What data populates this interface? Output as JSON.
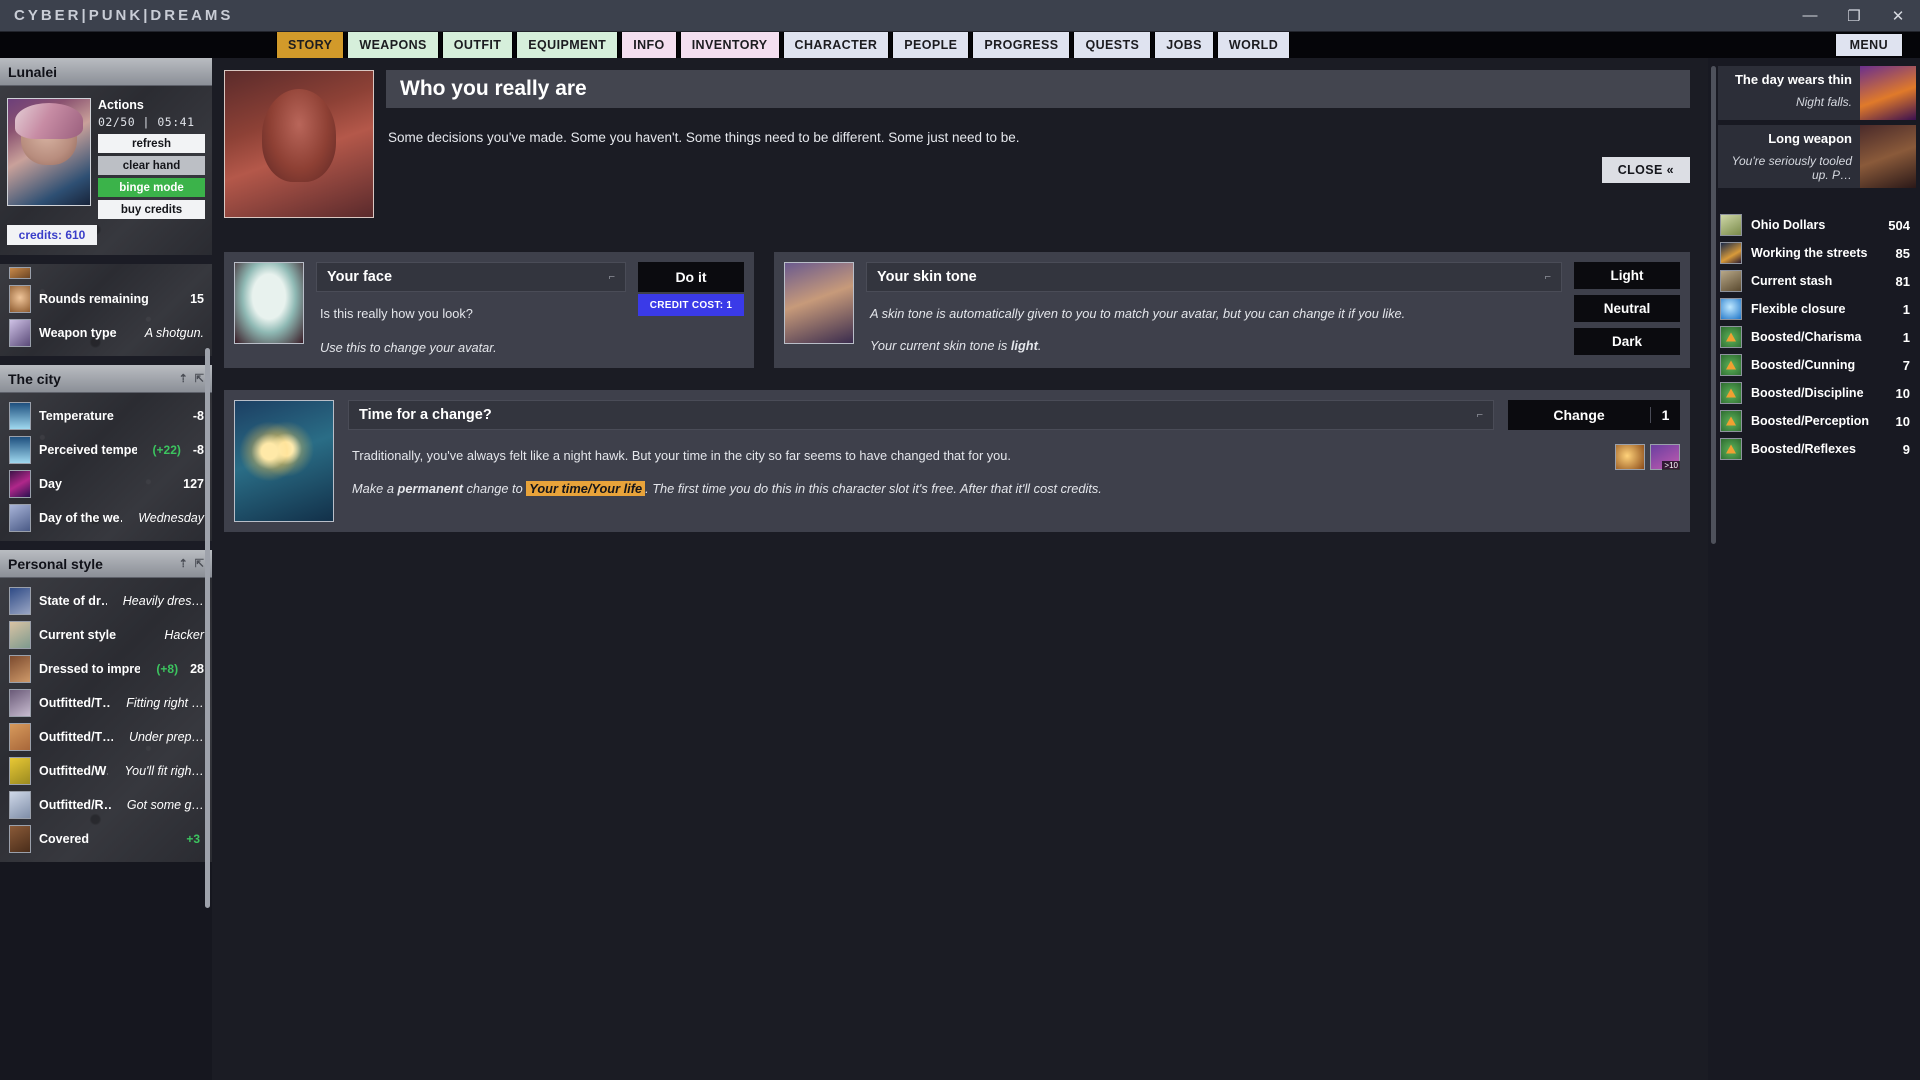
{
  "titlebar": {
    "brand": "CYBER|PUNK|DREAMS",
    "minimize": "—",
    "maximize": "❐",
    "close": "✕"
  },
  "tabs": [
    {
      "label": "STORY",
      "style": "story"
    },
    {
      "label": "WEAPONS",
      "style": "green"
    },
    {
      "label": "OUTFIT",
      "style": "green"
    },
    {
      "label": "EQUIPMENT",
      "style": "green"
    },
    {
      "label": "INFO",
      "style": "pink"
    },
    {
      "label": "INVENTORY",
      "style": "pink"
    },
    {
      "label": "CHARACTER",
      "style": "blue"
    },
    {
      "label": "PEOPLE",
      "style": "blue"
    },
    {
      "label": "PROGRESS",
      "style": "blue"
    },
    {
      "label": "QUESTS",
      "style": "blue"
    },
    {
      "label": "JOBS",
      "style": "blue"
    },
    {
      "label": "WORLD",
      "style": "blue"
    }
  ],
  "menu_label": "MENU",
  "sidebar_left": {
    "character": {
      "name": "Lunalei",
      "actions_title": "Actions",
      "actions_count": "02/50  |  05:41",
      "buttons": [
        {
          "label": "refresh",
          "style": "white"
        },
        {
          "label": "clear hand",
          "style": "grey"
        },
        {
          "label": "binge mode",
          "style": "green"
        },
        {
          "label": "buy credits",
          "style": "white"
        }
      ],
      "credits": "credits: 610"
    },
    "weapon_rows": [
      {
        "label": "Rounds remaining",
        "bonus": "",
        "value": "15",
        "italic": false
      },
      {
        "label": "Weapon type",
        "bonus": "",
        "value": "A shotgun.",
        "italic": true
      }
    ],
    "city": {
      "title": "The city",
      "rows": [
        {
          "label": "Temperature",
          "bonus": "",
          "value": "-8",
          "italic": false
        },
        {
          "label": "Perceived tempe…",
          "bonus": "(+22)",
          "value": "-8",
          "italic": false
        },
        {
          "label": "Day",
          "bonus": "",
          "value": "127",
          "italic": false
        },
        {
          "label": "Day of the we…",
          "bonus": "",
          "value": "Wednesday",
          "italic": true
        }
      ]
    },
    "style": {
      "title": "Personal style",
      "rows": [
        {
          "label": "State of dr…",
          "bonus": "",
          "value": "Heavily dres…",
          "italic": true
        },
        {
          "label": "Current style",
          "bonus": "",
          "value": "Hacker",
          "italic": true
        },
        {
          "label": "Dressed to impress",
          "bonus": "(+8)",
          "value": "28",
          "italic": false
        },
        {
          "label": "Outfitted/T…",
          "bonus": "",
          "value": "Fitting right …",
          "italic": true
        },
        {
          "label": "Outfitted/T…",
          "bonus": "",
          "value": "Under prep…",
          "italic": true
        },
        {
          "label": "Outfitted/W…",
          "bonus": "",
          "value": "You'll fit righ…",
          "italic": true
        },
        {
          "label": "Outfitted/R…",
          "bonus": "",
          "value": "Got some g…",
          "italic": true
        },
        {
          "label": "Covered",
          "bonus": "+3",
          "value": "",
          "italic": false
        }
      ]
    }
  },
  "story": {
    "title": "Who you really are",
    "text": "Some decisions you've made. Some you haven't. Some things need to be different. Some just need to be.",
    "close_label": "CLOSE «"
  },
  "cards": [
    {
      "title": "Your face",
      "body_line1": "Is this really how you look?",
      "body_line2": "Use this to change your avatar.",
      "pin": "⌐",
      "primary_label": "Do it",
      "cost_label": "CREDIT COST: 1"
    },
    {
      "title": "Your skin tone",
      "body_line1": "A skin tone is automatically given to you to match your avatar, but you can change it if you like.",
      "body_line2_prefix": "Your current skin tone is ",
      "body_line2_value": "light",
      "body_line2_suffix": ".",
      "pin": "⌐",
      "options": [
        "Light",
        "Neutral",
        "Dark"
      ]
    }
  ],
  "wide_card": {
    "title": "Time for a change?",
    "pin": "⌐",
    "line1": "Traditionally, you've always felt like a night hawk. But your time in the city so far seems to have changed that for you.",
    "line2_a": "Make a ",
    "line2_b": "permanent",
    "line2_c": " change to ",
    "line2_highlight": "Your time/Your life",
    "line2_d": ". The first time you do this in this character slot it's free. After that it'll cost credits.",
    "change_label": "Change",
    "change_count": "1",
    "chip_badge": ">10"
  },
  "sidebar_right": {
    "events": [
      {
        "title": "The day wears thin",
        "sub": "Night falls."
      },
      {
        "title": "Long weapon",
        "sub": "You're seriously tooled up. P…"
      }
    ],
    "resources": [
      {
        "name": "Ohio Dollars",
        "value": "504",
        "icon": "money-icon"
      },
      {
        "name": "Working the streets",
        "value": "85",
        "icon": "street-icon"
      },
      {
        "name": "Current stash",
        "value": "81",
        "icon": "stash-icon"
      },
      {
        "name": "Flexible closure",
        "value": "1",
        "icon": "closure-icon"
      },
      {
        "name": "Boosted/Charisma",
        "value": "1",
        "icon": "boost-arrow-icon"
      },
      {
        "name": "Boosted/Cunning",
        "value": "7",
        "icon": "boost-arrow-icon"
      },
      {
        "name": "Boosted/Discipline",
        "value": "10",
        "icon": "boost-arrow-icon"
      },
      {
        "name": "Boosted/Perception",
        "value": "10",
        "icon": "boost-arrow-icon"
      },
      {
        "name": "Boosted/Reflexes",
        "value": "9",
        "icon": "boost-arrow-icon"
      }
    ]
  },
  "colors": {
    "accent_story": "#d29a2a",
    "credit_blue": "#3a3ae8",
    "green": "#3bb34a",
    "highlight": "#e8a33a"
  }
}
